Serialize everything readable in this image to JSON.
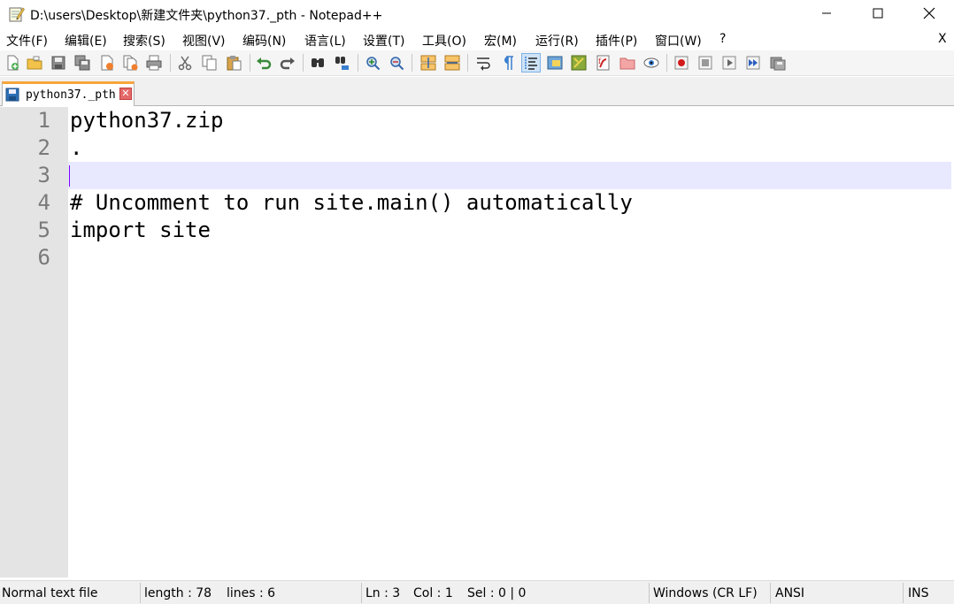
{
  "window": {
    "title": "D:\\users\\Desktop\\新建文件夹\\python37._pth - Notepad++",
    "app_icon": "notepad-icon"
  },
  "menu": {
    "items": [
      "文件(F)",
      "编辑(E)",
      "搜索(S)",
      "视图(V)",
      "编码(N)",
      "语言(L)",
      "设置(T)",
      "工具(O)",
      "宏(M)",
      "运行(R)",
      "插件(P)",
      "窗口(W)",
      "?"
    ],
    "close_label": "X"
  },
  "toolbar": {
    "icons": [
      "new-file-icon",
      "open-file-icon",
      "save-icon",
      "save-all-icon",
      "close-icon",
      "close-all-icon",
      "print-icon",
      "cut-icon",
      "copy-icon",
      "paste-icon",
      "undo-icon",
      "redo-icon",
      "find-icon",
      "replace-icon",
      "zoom-in-icon",
      "zoom-out-icon",
      "sync-vertical-icon",
      "sync-horizontal-icon",
      "word-wrap-icon",
      "show-all-chars-icon",
      "indent-guide-icon",
      "document-map-icon",
      "function-list-icon",
      "folder-workspace-icon",
      "folder-icon",
      "monitor-icon",
      "record-macro-icon",
      "stop-macro-icon",
      "play-macro-icon",
      "run-macro-multiple-icon",
      "save-macro-icon"
    ]
  },
  "tab": {
    "label": "python37._pth",
    "close_label": "✕"
  },
  "editor": {
    "line_numbers": [
      "1",
      "2",
      "3",
      "4",
      "5",
      "6"
    ],
    "lines": [
      "python37.zip",
      ".",
      "",
      "# Uncomment to run site.main() automatically",
      "import site",
      ""
    ],
    "current_line_color": "#e8e8ff",
    "caret_color": "#8000ff"
  },
  "status": {
    "file_type": "Normal text file",
    "length": "length : 78",
    "lines": "lines : 6",
    "ln": "Ln : 3",
    "col": "Col : 1",
    "sel": "Sel : 0 | 0",
    "eol": "Windows (CR LF)",
    "encoding": "ANSI",
    "mode": "INS"
  }
}
